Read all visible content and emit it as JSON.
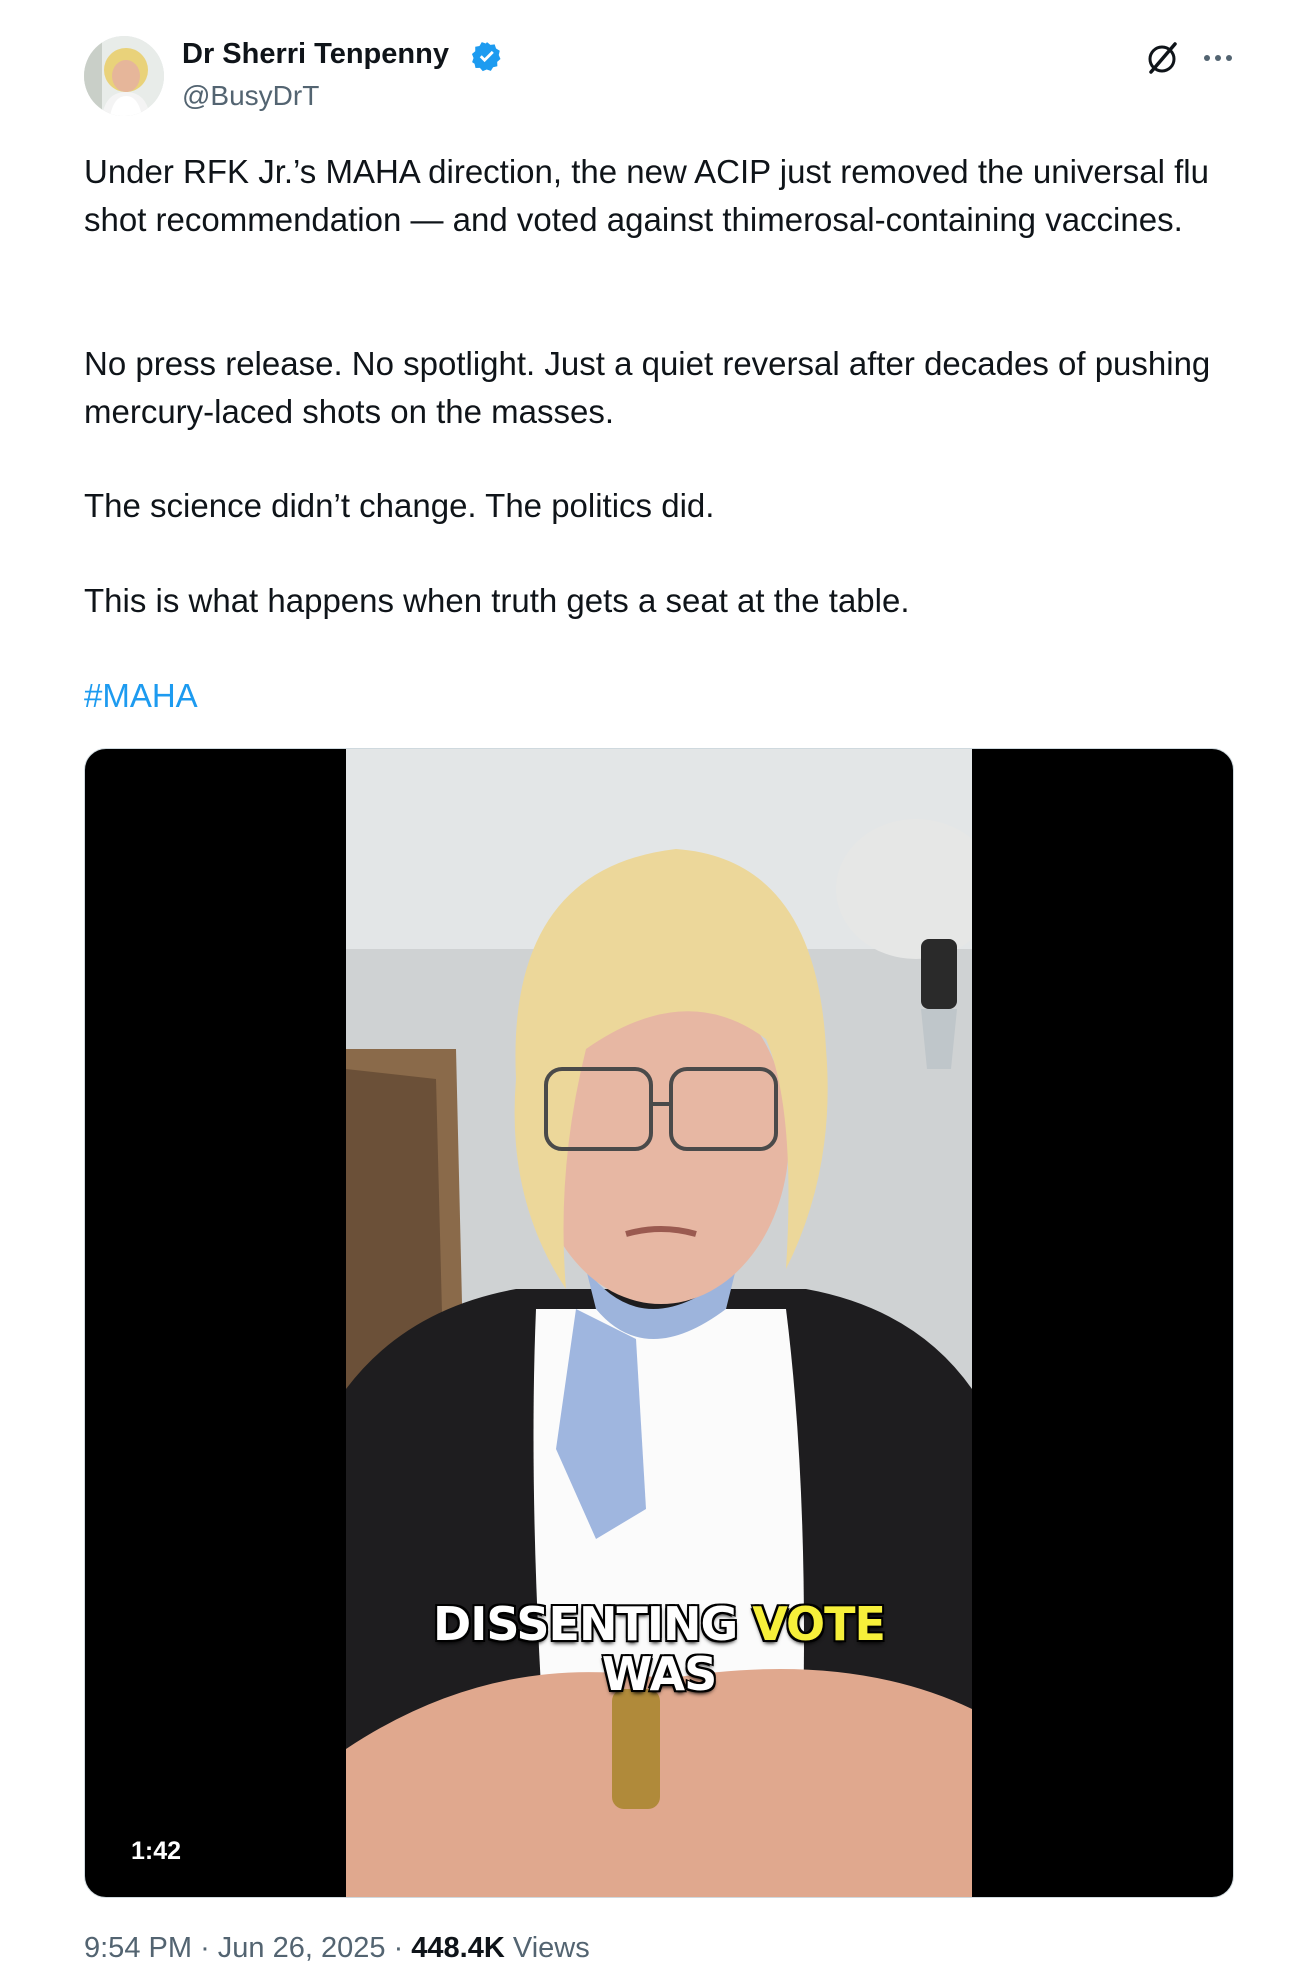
{
  "author": {
    "display_name": "Dr Sherri Tenpenny",
    "handle": "@BusyDrT",
    "verified": true
  },
  "post": {
    "paragraphs": [
      "Under RFK Jr.’s MAHA direction, the new ACIP just removed the universal flu shot recommendation — and voted against thimerosal-containing vaccines.",
      "No press release. No spotlight. Just a quiet reversal after decades of pushing mercury-laced shots on the masses.",
      "The science didn’t change. The politics did.",
      "This is what happens when truth gets a seat at the table."
    ],
    "hashtag": "#MAHA"
  },
  "video": {
    "duration": "1:42",
    "caption_word_1": "DISSENTING",
    "caption_word_2": "VOTE",
    "caption_line_2": "WAS"
  },
  "meta": {
    "time": "9:54 PM",
    "separator": "·",
    "date": "Jun 26, 2025",
    "views_count": "448.4K",
    "views_label": "Views"
  },
  "icons": {
    "grok": "grok-icon",
    "more": "more-icon",
    "verified": "verified-badge-icon"
  },
  "colors": {
    "link": "#1d9bf0",
    "secondary_text": "#536471",
    "caption_highlight": "#f6ef3a"
  }
}
